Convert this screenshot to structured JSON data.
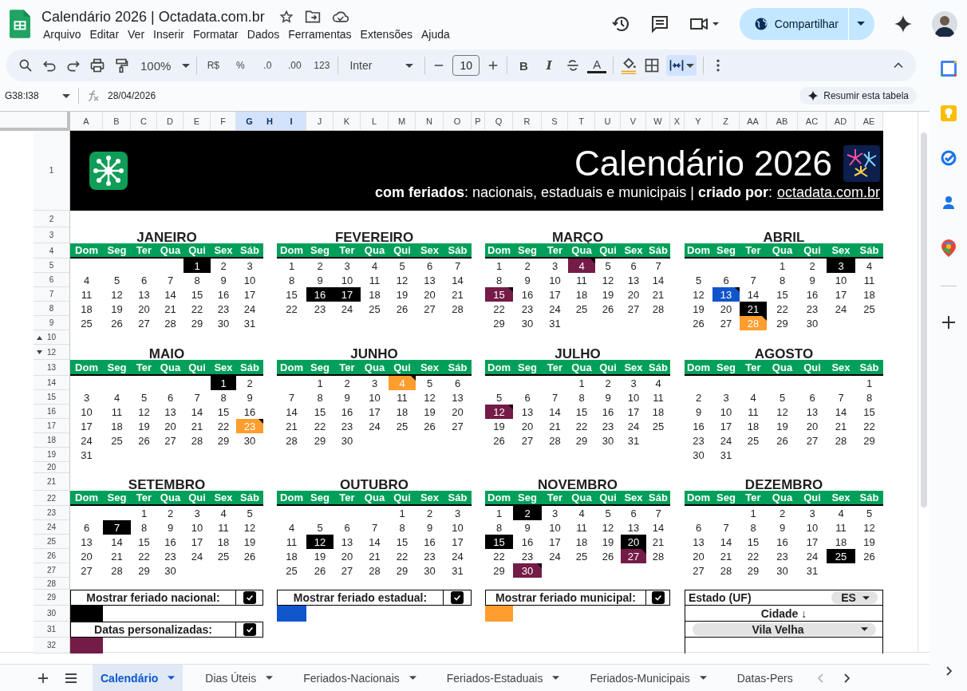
{
  "document": {
    "title": "Calendário 2026 | Octadata.com.br"
  },
  "menus": [
    "Arquivo",
    "Editar",
    "Ver",
    "Inserir",
    "Formatar",
    "Dados",
    "Ferramentas",
    "Extensões",
    "Ajuda"
  ],
  "share_button": "Compartilhar",
  "toolbar": {
    "zoom": "100%",
    "number_formats": [
      "R$",
      "%",
      ".0",
      ".00",
      "123"
    ],
    "font": "Inter",
    "font_size": "10",
    "text_styles": [
      "B",
      "I"
    ],
    "text_color": "A"
  },
  "formula_bar": {
    "cell_range": "G38:I38",
    "formula": "28/04/2026",
    "summarize_button": "Resumir esta tabela"
  },
  "columns": [
    {
      "label": "A",
      "selected": false
    },
    {
      "label": "B",
      "selected": false
    },
    {
      "label": "C",
      "selected": false
    },
    {
      "label": "D",
      "selected": false
    },
    {
      "label": "E",
      "selected": false
    },
    {
      "label": "F",
      "selected": false
    },
    {
      "label": "G",
      "selected": true
    },
    {
      "label": "H",
      "selected": true
    },
    {
      "label": "I",
      "selected": true
    },
    {
      "label": "J",
      "selected": false
    },
    {
      "label": "K",
      "selected": false
    },
    {
      "label": "L",
      "selected": false
    },
    {
      "label": "M",
      "selected": false
    },
    {
      "label": "N",
      "selected": false
    },
    {
      "label": "O",
      "selected": false
    },
    {
      "label": "P",
      "selected": false
    },
    {
      "label": "Q",
      "selected": false
    },
    {
      "label": "R",
      "selected": false
    },
    {
      "label": "S",
      "selected": false
    },
    {
      "label": "T",
      "selected": false
    },
    {
      "label": "U",
      "selected": false
    },
    {
      "label": "V",
      "selected": false
    },
    {
      "label": "W",
      "selected": false
    },
    {
      "label": "X",
      "selected": false
    },
    {
      "label": "Y",
      "selected": false
    },
    {
      "label": "Z",
      "selected": false
    },
    {
      "label": "AA",
      "selected": false
    },
    {
      "label": "AB",
      "selected": false
    },
    {
      "label": "AC",
      "selected": false
    },
    {
      "label": "AD",
      "selected": false
    },
    {
      "label": "AE",
      "selected": false
    }
  ],
  "rows": [
    {
      "label": "1",
      "hidden_below": false,
      "hidden_above": false
    },
    {
      "label": "2",
      "hidden_below": false,
      "hidden_above": false
    },
    {
      "label": "3",
      "hidden_below": false,
      "hidden_above": false
    },
    {
      "label": "4",
      "hidden_below": false,
      "hidden_above": false
    },
    {
      "label": "5",
      "hidden_below": false,
      "hidden_above": false
    },
    {
      "label": "6",
      "hidden_below": false,
      "hidden_above": false
    },
    {
      "label": "7",
      "hidden_below": false,
      "hidden_above": false
    },
    {
      "label": "8",
      "hidden_below": false,
      "hidden_above": false
    },
    {
      "label": "9",
      "hidden_below": false,
      "hidden_above": false
    },
    {
      "label": "10",
      "hidden_below": true,
      "hidden_above": false
    },
    {
      "label": "12",
      "hidden_below": false,
      "hidden_above": true
    },
    {
      "label": "13",
      "hidden_below": false,
      "hidden_above": false
    },
    {
      "label": "14",
      "hidden_below": false,
      "hidden_above": false
    },
    {
      "label": "15",
      "hidden_below": false,
      "hidden_above": false
    },
    {
      "label": "16",
      "hidden_below": false,
      "hidden_above": false
    },
    {
      "label": "17",
      "hidden_below": false,
      "hidden_above": false
    },
    {
      "label": "18",
      "hidden_below": false,
      "hidden_above": false
    },
    {
      "label": "19",
      "hidden_below": false,
      "hidden_above": false
    },
    {
      "label": "20",
      "hidden_below": false,
      "hidden_above": false
    },
    {
      "label": "21",
      "hidden_below": false,
      "hidden_above": false
    },
    {
      "label": "22",
      "hidden_below": false,
      "hidden_above": false
    },
    {
      "label": "23",
      "hidden_below": false,
      "hidden_above": false
    },
    {
      "label": "24",
      "hidden_below": false,
      "hidden_above": false
    },
    {
      "label": "25",
      "hidden_below": false,
      "hidden_above": false
    },
    {
      "label": "26",
      "hidden_below": false,
      "hidden_above": false
    },
    {
      "label": "27",
      "hidden_below": false,
      "hidden_above": false
    },
    {
      "label": "28",
      "hidden_below": false,
      "hidden_above": false
    },
    {
      "label": "29",
      "hidden_below": false,
      "hidden_above": false
    },
    {
      "label": "30",
      "hidden_below": false,
      "hidden_above": false
    },
    {
      "label": "31",
      "hidden_below": false,
      "hidden_above": false
    },
    {
      "label": "32",
      "hidden_below": false,
      "hidden_above": false
    }
  ],
  "banner": {
    "title": "Calendário 2026",
    "subtitle": "**com feriados**: nacionais, estaduais e municipais | **criado por**:",
    "link": "octadata.com.br"
  },
  "months": [
    {
      "name": "JANEIRO",
      "weekdays": [
        "Dom",
        "Seg",
        "Ter",
        "Qua",
        "Qui",
        "Sex",
        "Sáb"
      ],
      "weeks": [
        [
          {
            "day": "1",
            "kind": "nacional"
          },
          {
            "day": "2",
            "kind": "normal"
          },
          {
            "day": "3",
            "kind": "normal"
          }
        ],
        [
          {
            "day": "4",
            "kind": "normal"
          },
          {
            "day": "5",
            "kind": "normal"
          },
          {
            "day": "6",
            "kind": "normal"
          },
          {
            "day": "7",
            "kind": "normal"
          },
          {
            "day": "8",
            "kind": "normal"
          },
          {
            "day": "9",
            "kind": "normal"
          },
          {
            "day": "10",
            "kind": "normal"
          }
        ],
        [
          {
            "day": "11",
            "kind": "normal"
          },
          {
            "day": "12",
            "kind": "normal"
          },
          {
            "day": "13",
            "kind": "normal"
          },
          {
            "day": "14",
            "kind": "normal"
          },
          {
            "day": "15",
            "kind": "normal"
          },
          {
            "day": "16",
            "kind": "normal"
          },
          {
            "day": "17",
            "kind": "normal"
          }
        ],
        [
          {
            "day": "18",
            "kind": "normal"
          },
          {
            "day": "19",
            "kind": "normal"
          },
          {
            "day": "20",
            "kind": "normal"
          },
          {
            "day": "21",
            "kind": "normal"
          },
          {
            "day": "22",
            "kind": "normal"
          },
          {
            "day": "23",
            "kind": "normal"
          },
          {
            "day": "24",
            "kind": "normal"
          }
        ],
        [
          {
            "day": "25",
            "kind": "normal"
          },
          {
            "day": "26",
            "kind": "normal"
          },
          {
            "day": "27",
            "kind": "normal"
          },
          {
            "day": "28",
            "kind": "normal"
          },
          {
            "day": "29",
            "kind": "normal"
          },
          {
            "day": "30",
            "kind": "normal"
          },
          {
            "day": "31",
            "kind": "normal"
          }
        ]
      ]
    },
    {
      "name": "FEVEREIRO",
      "weekdays": [
        "Dom",
        "Seg",
        "Ter",
        "Qua",
        "Qui",
        "Sex",
        "Sáb"
      ],
      "weeks": [
        [
          {
            "day": "1",
            "kind": "normal"
          },
          {
            "day": "2",
            "kind": "normal"
          },
          {
            "day": "3",
            "kind": "normal"
          },
          {
            "day": "4",
            "kind": "normal"
          },
          {
            "day": "5",
            "kind": "normal"
          },
          {
            "day": "6",
            "kind": "normal"
          },
          {
            "day": "7",
            "kind": "normal"
          }
        ],
        [
          {
            "day": "8",
            "kind": "normal"
          },
          {
            "day": "9",
            "kind": "normal"
          },
          {
            "day": "10",
            "kind": "normal"
          },
          {
            "day": "11",
            "kind": "normal"
          },
          {
            "day": "12",
            "kind": "normal"
          },
          {
            "day": "13",
            "kind": "normal"
          },
          {
            "day": "14",
            "kind": "normal"
          }
        ],
        [
          {
            "day": "15",
            "kind": "normal"
          },
          {
            "day": "16",
            "kind": "nacional"
          },
          {
            "day": "17",
            "kind": "nacional"
          },
          {
            "day": "18",
            "kind": "normal"
          },
          {
            "day": "19",
            "kind": "normal"
          },
          {
            "day": "20",
            "kind": "normal"
          },
          {
            "day": "21",
            "kind": "normal"
          }
        ],
        [
          {
            "day": "22",
            "kind": "normal"
          },
          {
            "day": "23",
            "kind": "normal"
          },
          {
            "day": "24",
            "kind": "normal"
          },
          {
            "day": "25",
            "kind": "normal"
          },
          {
            "day": "26",
            "kind": "normal"
          },
          {
            "day": "27",
            "kind": "normal"
          },
          {
            "day": "28",
            "kind": "normal"
          }
        ]
      ]
    },
    {
      "name": "MARÇO",
      "weekdays": [
        "Dom",
        "Seg",
        "Ter",
        "Qua",
        "Qui",
        "Sex",
        "Sáb"
      ],
      "weeks": [
        [
          {
            "day": "1",
            "kind": "normal"
          },
          {
            "day": "2",
            "kind": "normal"
          },
          {
            "day": "3",
            "kind": "normal"
          },
          {
            "day": "4",
            "kind": "personalizada"
          },
          {
            "day": "5",
            "kind": "normal"
          },
          {
            "day": "6",
            "kind": "normal"
          },
          {
            "day": "7",
            "kind": "normal"
          }
        ],
        [
          {
            "day": "8",
            "kind": "normal"
          },
          {
            "day": "9",
            "kind": "normal"
          },
          {
            "day": "10",
            "kind": "normal"
          },
          {
            "day": "11",
            "kind": "normal"
          },
          {
            "day": "12",
            "kind": "normal"
          },
          {
            "day": "13",
            "kind": "normal"
          },
          {
            "day": "14",
            "kind": "normal"
          }
        ],
        [
          {
            "day": "15",
            "kind": "personalizada"
          },
          {
            "day": "16",
            "kind": "normal"
          },
          {
            "day": "17",
            "kind": "normal"
          },
          {
            "day": "18",
            "kind": "normal"
          },
          {
            "day": "19",
            "kind": "normal"
          },
          {
            "day": "20",
            "kind": "normal"
          },
          {
            "day": "21",
            "kind": "normal"
          }
        ],
        [
          {
            "day": "22",
            "kind": "normal"
          },
          {
            "day": "23",
            "kind": "normal"
          },
          {
            "day": "24",
            "kind": "normal"
          },
          {
            "day": "25",
            "kind": "normal"
          },
          {
            "day": "26",
            "kind": "normal"
          },
          {
            "day": "27",
            "kind": "normal"
          },
          {
            "day": "28",
            "kind": "normal"
          }
        ],
        [
          {
            "day": "29",
            "kind": "normal"
          },
          {
            "day": "30",
            "kind": "normal"
          },
          {
            "day": "31",
            "kind": "normal"
          }
        ]
      ]
    },
    {
      "name": "ABRIL",
      "weekdays": [
        "Dom",
        "Seg",
        "Ter",
        "Qua",
        "Qui",
        "Sex",
        "Sáb"
      ],
      "weeks": [
        [
          {
            "day": "1",
            "kind": "normal"
          },
          {
            "day": "2",
            "kind": "normal"
          },
          {
            "day": "3",
            "kind": "nacional"
          },
          {
            "day": "4",
            "kind": "normal"
          }
        ],
        [
          {
            "day": "5",
            "kind": "normal"
          },
          {
            "day": "6",
            "kind": "normal"
          },
          {
            "day": "7",
            "kind": "normal"
          },
          {
            "day": "8",
            "kind": "normal"
          },
          {
            "day": "9",
            "kind": "normal"
          },
          {
            "day": "10",
            "kind": "normal"
          },
          {
            "day": "11",
            "kind": "normal"
          }
        ],
        [
          {
            "day": "12",
            "kind": "normal"
          },
          {
            "day": "13",
            "kind": "estadual"
          },
          {
            "day": "14",
            "kind": "normal"
          },
          {
            "day": "15",
            "kind": "normal"
          },
          {
            "day": "16",
            "kind": "normal"
          },
          {
            "day": "17",
            "kind": "normal"
          },
          {
            "day": "18",
            "kind": "normal"
          }
        ],
        [
          {
            "day": "19",
            "kind": "normal"
          },
          {
            "day": "20",
            "kind": "normal"
          },
          {
            "day": "21",
            "kind": "nacional"
          },
          {
            "day": "22",
            "kind": "normal"
          },
          {
            "day": "23",
            "kind": "normal"
          },
          {
            "day": "24",
            "kind": "normal"
          },
          {
            "day": "25",
            "kind": "normal"
          }
        ],
        [
          {
            "day": "26",
            "kind": "normal"
          },
          {
            "day": "27",
            "kind": "normal"
          },
          {
            "day": "28",
            "kind": "municipal"
          },
          {
            "day": "29",
            "kind": "normal"
          },
          {
            "day": "30",
            "kind": "normal"
          }
        ]
      ]
    },
    {
      "name": "MAIO",
      "weekdays": [
        "Dom",
        "Seg",
        "Ter",
        "Qua",
        "Qui",
        "Sex",
        "Sáb"
      ],
      "weeks": [
        [
          {
            "day": "1",
            "kind": "nacional"
          },
          {
            "day": "2",
            "kind": "normal"
          }
        ],
        [
          {
            "day": "3",
            "kind": "normal"
          },
          {
            "day": "4",
            "kind": "normal"
          },
          {
            "day": "5",
            "kind": "normal"
          },
          {
            "day": "6",
            "kind": "normal"
          },
          {
            "day": "7",
            "kind": "normal"
          },
          {
            "day": "8",
            "kind": "normal"
          },
          {
            "day": "9",
            "kind": "normal"
          }
        ],
        [
          {
            "day": "10",
            "kind": "normal"
          },
          {
            "day": "11",
            "kind": "normal"
          },
          {
            "day": "12",
            "kind": "normal"
          },
          {
            "day": "13",
            "kind": "normal"
          },
          {
            "day": "14",
            "kind": "normal"
          },
          {
            "day": "15",
            "kind": "normal"
          },
          {
            "day": "16",
            "kind": "normal"
          }
        ],
        [
          {
            "day": "17",
            "kind": "normal"
          },
          {
            "day": "18",
            "kind": "normal"
          },
          {
            "day": "19",
            "kind": "normal"
          },
          {
            "day": "20",
            "kind": "normal"
          },
          {
            "day": "21",
            "kind": "normal"
          },
          {
            "day": "22",
            "kind": "normal"
          },
          {
            "day": "23",
            "kind": "municipal"
          }
        ],
        [
          {
            "day": "24",
            "kind": "normal"
          },
          {
            "day": "25",
            "kind": "normal"
          },
          {
            "day": "26",
            "kind": "normal"
          },
          {
            "day": "27",
            "kind": "normal"
          },
          {
            "day": "28",
            "kind": "normal"
          },
          {
            "day": "29",
            "kind": "normal"
          },
          {
            "day": "30",
            "kind": "normal"
          }
        ],
        [
          {
            "day": "31",
            "kind": "normal"
          }
        ]
      ]
    },
    {
      "name": "JUNHO",
      "weekdays": [
        "Dom",
        "Seg",
        "Ter",
        "Qua",
        "Qui",
        "Sex",
        "Sáb"
      ],
      "weeks": [
        [
          {
            "day": "1",
            "kind": "normal"
          },
          {
            "day": "2",
            "kind": "normal"
          },
          {
            "day": "3",
            "kind": "normal"
          },
          {
            "day": "4",
            "kind": "municipal"
          },
          {
            "day": "5",
            "kind": "normal"
          },
          {
            "day": "6",
            "kind": "normal"
          }
        ],
        [
          {
            "day": "7",
            "kind": "normal"
          },
          {
            "day": "8",
            "kind": "normal"
          },
          {
            "day": "9",
            "kind": "normal"
          },
          {
            "day": "10",
            "kind": "normal"
          },
          {
            "day": "11",
            "kind": "normal"
          },
          {
            "day": "12",
            "kind": "normal"
          },
          {
            "day": "13",
            "kind": "normal"
          }
        ],
        [
          {
            "day": "14",
            "kind": "normal"
          },
          {
            "day": "15",
            "kind": "normal"
          },
          {
            "day": "16",
            "kind": "normal"
          },
          {
            "day": "17",
            "kind": "normal"
          },
          {
            "day": "18",
            "kind": "normal"
          },
          {
            "day": "19",
            "kind": "normal"
          },
          {
            "day": "20",
            "kind": "normal"
          }
        ],
        [
          {
            "day": "21",
            "kind": "normal"
          },
          {
            "day": "22",
            "kind": "normal"
          },
          {
            "day": "23",
            "kind": "normal"
          },
          {
            "day": "24",
            "kind": "normal"
          },
          {
            "day": "25",
            "kind": "normal"
          },
          {
            "day": "26",
            "kind": "normal"
          },
          {
            "day": "27",
            "kind": "normal"
          }
        ],
        [
          {
            "day": "28",
            "kind": "normal"
          },
          {
            "day": "29",
            "kind": "normal"
          },
          {
            "day": "30",
            "kind": "normal"
          }
        ]
      ]
    },
    {
      "name": "JULHO",
      "weekdays": [
        "Dom",
        "Seg",
        "Ter",
        "Qua",
        "Qui",
        "Sex",
        "Sáb"
      ],
      "weeks": [
        [
          {
            "day": "1",
            "kind": "normal"
          },
          {
            "day": "2",
            "kind": "normal"
          },
          {
            "day": "3",
            "kind": "normal"
          },
          {
            "day": "4",
            "kind": "normal"
          }
        ],
        [
          {
            "day": "5",
            "kind": "normal"
          },
          {
            "day": "6",
            "kind": "normal"
          },
          {
            "day": "7",
            "kind": "normal"
          },
          {
            "day": "8",
            "kind": "normal"
          },
          {
            "day": "9",
            "kind": "normal"
          },
          {
            "day": "10",
            "kind": "normal"
          },
          {
            "day": "11",
            "kind": "normal"
          }
        ],
        [
          {
            "day": "12",
            "kind": "personalizada"
          },
          {
            "day": "13",
            "kind": "normal"
          },
          {
            "day": "14",
            "kind": "normal"
          },
          {
            "day": "15",
            "kind": "normal"
          },
          {
            "day": "16",
            "kind": "normal"
          },
          {
            "day": "17",
            "kind": "normal"
          },
          {
            "day": "18",
            "kind": "normal"
          }
        ],
        [
          {
            "day": "19",
            "kind": "normal"
          },
          {
            "day": "20",
            "kind": "normal"
          },
          {
            "day": "21",
            "kind": "normal"
          },
          {
            "day": "22",
            "kind": "normal"
          },
          {
            "day": "23",
            "kind": "normal"
          },
          {
            "day": "24",
            "kind": "normal"
          },
          {
            "day": "25",
            "kind": "normal"
          }
        ],
        [
          {
            "day": "26",
            "kind": "normal"
          },
          {
            "day": "27",
            "kind": "normal"
          },
          {
            "day": "28",
            "kind": "normal"
          },
          {
            "day": "29",
            "kind": "normal"
          },
          {
            "day": "30",
            "kind": "normal"
          },
          {
            "day": "31",
            "kind": "normal"
          }
        ]
      ]
    },
    {
      "name": "AGOSTO",
      "weekdays": [
        "Dom",
        "Seg",
        "Ter",
        "Qua",
        "Qui",
        "Sex",
        "Sáb"
      ],
      "weeks": [
        [
          {
            "day": "1",
            "kind": "normal"
          }
        ],
        [
          {
            "day": "2",
            "kind": "normal"
          },
          {
            "day": "3",
            "kind": "normal"
          },
          {
            "day": "4",
            "kind": "normal"
          },
          {
            "day": "5",
            "kind": "normal"
          },
          {
            "day": "6",
            "kind": "normal"
          },
          {
            "day": "7",
            "kind": "normal"
          },
          {
            "day": "8",
            "kind": "normal"
          }
        ],
        [
          {
            "day": "9",
            "kind": "normal"
          },
          {
            "day": "10",
            "kind": "normal"
          },
          {
            "day": "11",
            "kind": "normal"
          },
          {
            "day": "12",
            "kind": "normal"
          },
          {
            "day": "13",
            "kind": "normal"
          },
          {
            "day": "14",
            "kind": "normal"
          },
          {
            "day": "15",
            "kind": "normal"
          }
        ],
        [
          {
            "day": "16",
            "kind": "normal"
          },
          {
            "day": "17",
            "kind": "normal"
          },
          {
            "day": "18",
            "kind": "normal"
          },
          {
            "day": "19",
            "kind": "normal"
          },
          {
            "day": "20",
            "kind": "normal"
          },
          {
            "day": "21",
            "kind": "normal"
          },
          {
            "day": "22",
            "kind": "normal"
          }
        ],
        [
          {
            "day": "23",
            "kind": "normal"
          },
          {
            "day": "24",
            "kind": "normal"
          },
          {
            "day": "25",
            "kind": "normal"
          },
          {
            "day": "26",
            "kind": "normal"
          },
          {
            "day": "27",
            "kind": "normal"
          },
          {
            "day": "28",
            "kind": "normal"
          },
          {
            "day": "29",
            "kind": "normal"
          }
        ],
        [
          {
            "day": "30",
            "kind": "normal"
          },
          {
            "day": "31",
            "kind": "normal"
          }
        ]
      ]
    },
    {
      "name": "SETEMBRO",
      "weekdays": [
        "Dom",
        "Seg",
        "Ter",
        "Qua",
        "Qui",
        "Sex",
        "Sáb"
      ],
      "weeks": [
        [
          {
            "day": "1",
            "kind": "normal"
          },
          {
            "day": "2",
            "kind": "normal"
          },
          {
            "day": "3",
            "kind": "normal"
          },
          {
            "day": "4",
            "kind": "normal"
          },
          {
            "day": "5",
            "kind": "normal"
          }
        ],
        [
          {
            "day": "6",
            "kind": "normal"
          },
          {
            "day": "7",
            "kind": "nacional"
          },
          {
            "day": "8",
            "kind": "normal"
          },
          {
            "day": "9",
            "kind": "normal"
          },
          {
            "day": "10",
            "kind": "normal"
          },
          {
            "day": "11",
            "kind": "normal"
          },
          {
            "day": "12",
            "kind": "normal"
          }
        ],
        [
          {
            "day": "13",
            "kind": "normal"
          },
          {
            "day": "14",
            "kind": "normal"
          },
          {
            "day": "15",
            "kind": "normal"
          },
          {
            "day": "16",
            "kind": "normal"
          },
          {
            "day": "17",
            "kind": "normal"
          },
          {
            "day": "18",
            "kind": "normal"
          },
          {
            "day": "19",
            "kind": "normal"
          }
        ],
        [
          {
            "day": "20",
            "kind": "normal"
          },
          {
            "day": "21",
            "kind": "normal"
          },
          {
            "day": "22",
            "kind": "normal"
          },
          {
            "day": "23",
            "kind": "normal"
          },
          {
            "day": "24",
            "kind": "normal"
          },
          {
            "day": "25",
            "kind": "normal"
          },
          {
            "day": "26",
            "kind": "normal"
          }
        ],
        [
          {
            "day": "27",
            "kind": "normal"
          },
          {
            "day": "28",
            "kind": "normal"
          },
          {
            "day": "29",
            "kind": "normal"
          },
          {
            "day": "30",
            "kind": "normal"
          }
        ]
      ]
    },
    {
      "name": "OUTUBRO",
      "weekdays": [
        "Dom",
        "Seg",
        "Ter",
        "Qua",
        "Qui",
        "Sex",
        "Sáb"
      ],
      "weeks": [
        [
          {
            "day": "1",
            "kind": "normal"
          },
          {
            "day": "2",
            "kind": "normal"
          },
          {
            "day": "3",
            "kind": "normal"
          }
        ],
        [
          {
            "day": "4",
            "kind": "normal"
          },
          {
            "day": "5",
            "kind": "normal"
          },
          {
            "day": "6",
            "kind": "normal"
          },
          {
            "day": "7",
            "kind": "normal"
          },
          {
            "day": "8",
            "kind": "normal"
          },
          {
            "day": "9",
            "kind": "normal"
          },
          {
            "day": "10",
            "kind": "normal"
          }
        ],
        [
          {
            "day": "11",
            "kind": "normal"
          },
          {
            "day": "12",
            "kind": "nacional"
          },
          {
            "day": "13",
            "kind": "normal"
          },
          {
            "day": "14",
            "kind": "normal"
          },
          {
            "day": "15",
            "kind": "normal"
          },
          {
            "day": "16",
            "kind": "normal"
          },
          {
            "day": "17",
            "kind": "normal"
          }
        ],
        [
          {
            "day": "18",
            "kind": "normal"
          },
          {
            "day": "19",
            "kind": "normal"
          },
          {
            "day": "20",
            "kind": "normal"
          },
          {
            "day": "21",
            "kind": "normal"
          },
          {
            "day": "22",
            "kind": "normal"
          },
          {
            "day": "23",
            "kind": "normal"
          },
          {
            "day": "24",
            "kind": "normal"
          }
        ],
        [
          {
            "day": "25",
            "kind": "normal"
          },
          {
            "day": "26",
            "kind": "normal"
          },
          {
            "day": "27",
            "kind": "normal"
          },
          {
            "day": "28",
            "kind": "normal"
          },
          {
            "day": "29",
            "kind": "normal"
          },
          {
            "day": "30",
            "kind": "normal"
          },
          {
            "day": "31",
            "kind": "normal"
          }
        ]
      ]
    },
    {
      "name": "NOVEMBRO",
      "weekdays": [
        "Dom",
        "Seg",
        "Ter",
        "Qua",
        "Qui",
        "Sex",
        "Sáb"
      ],
      "weeks": [
        [
          {
            "day": "1",
            "kind": "normal"
          },
          {
            "day": "2",
            "kind": "nacional"
          },
          {
            "day": "3",
            "kind": "normal"
          },
          {
            "day": "4",
            "kind": "normal"
          },
          {
            "day": "5",
            "kind": "normal"
          },
          {
            "day": "6",
            "kind": "normal"
          },
          {
            "day": "7",
            "kind": "normal"
          }
        ],
        [
          {
            "day": "8",
            "kind": "normal"
          },
          {
            "day": "9",
            "kind": "normal"
          },
          {
            "day": "10",
            "kind": "normal"
          },
          {
            "day": "11",
            "kind": "normal"
          },
          {
            "day": "12",
            "kind": "normal"
          },
          {
            "day": "13",
            "kind": "normal"
          },
          {
            "day": "14",
            "kind": "normal"
          }
        ],
        [
          {
            "day": "15",
            "kind": "nacional"
          },
          {
            "day": "16",
            "kind": "normal"
          },
          {
            "day": "17",
            "kind": "normal"
          },
          {
            "day": "18",
            "kind": "normal"
          },
          {
            "day": "19",
            "kind": "normal"
          },
          {
            "day": "20",
            "kind": "nacional"
          },
          {
            "day": "21",
            "kind": "normal"
          }
        ],
        [
          {
            "day": "22",
            "kind": "normal"
          },
          {
            "day": "23",
            "kind": "normal"
          },
          {
            "day": "24",
            "kind": "normal"
          },
          {
            "day": "25",
            "kind": "normal"
          },
          {
            "day": "26",
            "kind": "normal"
          },
          {
            "day": "27",
            "kind": "personalizada"
          },
          {
            "day": "28",
            "kind": "normal"
          }
        ],
        [
          {
            "day": "29",
            "kind": "normal"
          },
          {
            "day": "30",
            "kind": "personalizada"
          }
        ]
      ]
    },
    {
      "name": "DEZEMBRO",
      "weekdays": [
        "Dom",
        "Seg",
        "Ter",
        "Qua",
        "Qui",
        "Sex",
        "Sáb"
      ],
      "weeks": [
        [
          {
            "day": "1",
            "kind": "normal"
          },
          {
            "day": "2",
            "kind": "normal"
          },
          {
            "day": "3",
            "kind": "normal"
          },
          {
            "day": "4",
            "kind": "normal"
          },
          {
            "day": "5",
            "kind": "normal"
          }
        ],
        [
          {
            "day": "6",
            "kind": "normal"
          },
          {
            "day": "7",
            "kind": "normal"
          },
          {
            "day": "8",
            "kind": "normal"
          },
          {
            "day": "9",
            "kind": "normal"
          },
          {
            "day": "10",
            "kind": "normal"
          },
          {
            "day": "11",
            "kind": "normal"
          },
          {
            "day": "12",
            "kind": "normal"
          }
        ],
        [
          {
            "day": "13",
            "kind": "normal"
          },
          {
            "day": "14",
            "kind": "normal"
          },
          {
            "day": "15",
            "kind": "normal"
          },
          {
            "day": "16",
            "kind": "normal"
          },
          {
            "day": "17",
            "kind": "normal"
          },
          {
            "day": "18",
            "kind": "normal"
          },
          {
            "day": "19",
            "kind": "normal"
          }
        ],
        [
          {
            "day": "20",
            "kind": "normal"
          },
          {
            "day": "21",
            "kind": "normal"
          },
          {
            "day": "22",
            "kind": "normal"
          },
          {
            "day": "23",
            "kind": "normal"
          },
          {
            "day": "24",
            "kind": "normal"
          },
          {
            "day": "25",
            "kind": "nacional"
          },
          {
            "day": "26",
            "kind": "normal"
          }
        ],
        [
          {
            "day": "27",
            "kind": "normal"
          },
          {
            "day": "28",
            "kind": "normal"
          },
          {
            "day": "29",
            "kind": "normal"
          },
          {
            "day": "30",
            "kind": "normal"
          },
          {
            "day": "31",
            "kind": "normal"
          }
        ]
      ]
    }
  ],
  "legend": [
    {
      "label": "Mostrar feriado nacional:",
      "kind": "nacional",
      "checked": true,
      "color": "#000000"
    },
    {
      "label": "Mostrar feriado estadual:",
      "kind": "estadual",
      "checked": true,
      "color": "#1155cc"
    },
    {
      "label": "Mostrar feriado municipal:",
      "kind": "municipal",
      "checked": true,
      "color": "#ff9d2e"
    },
    {
      "label": "Datas personalizadas:",
      "kind": "personalizada",
      "checked": true,
      "color": "#741b47"
    }
  ],
  "location": {
    "state_label": "Estado (UF)",
    "state": "ES",
    "city_label": "Cidade ↓",
    "city": "Vila Velha"
  },
  "sheet_tabs": [
    {
      "label": "Calendário",
      "selected": true
    },
    {
      "label": "Dias Úteis",
      "selected": false
    },
    {
      "label": "Feriados-Nacionais",
      "selected": false
    },
    {
      "label": "Feriados-Estaduais",
      "selected": false
    },
    {
      "label": "Feriados-Municipais",
      "selected": false
    },
    {
      "label": "Datas-Pers",
      "selected": false
    }
  ]
}
